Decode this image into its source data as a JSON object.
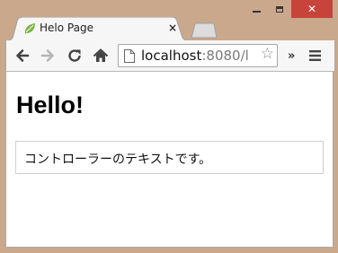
{
  "window": {
    "minimize_label": "minimize",
    "maximize_label": "maximize",
    "close_label": "close"
  },
  "tab": {
    "title": "Helo Page",
    "close_glyph": "×"
  },
  "toolbar": {
    "url_host": "localhost",
    "url_rest": ":8080/l",
    "star_glyph": "☆",
    "overflow_glyph": "»"
  },
  "page": {
    "heading": "Hello!",
    "box_text": "コントローラーのテキストです。"
  },
  "colors": {
    "frame": "#c9a88c",
    "close_button": "#c7443a",
    "favicon": "#7cb342"
  }
}
